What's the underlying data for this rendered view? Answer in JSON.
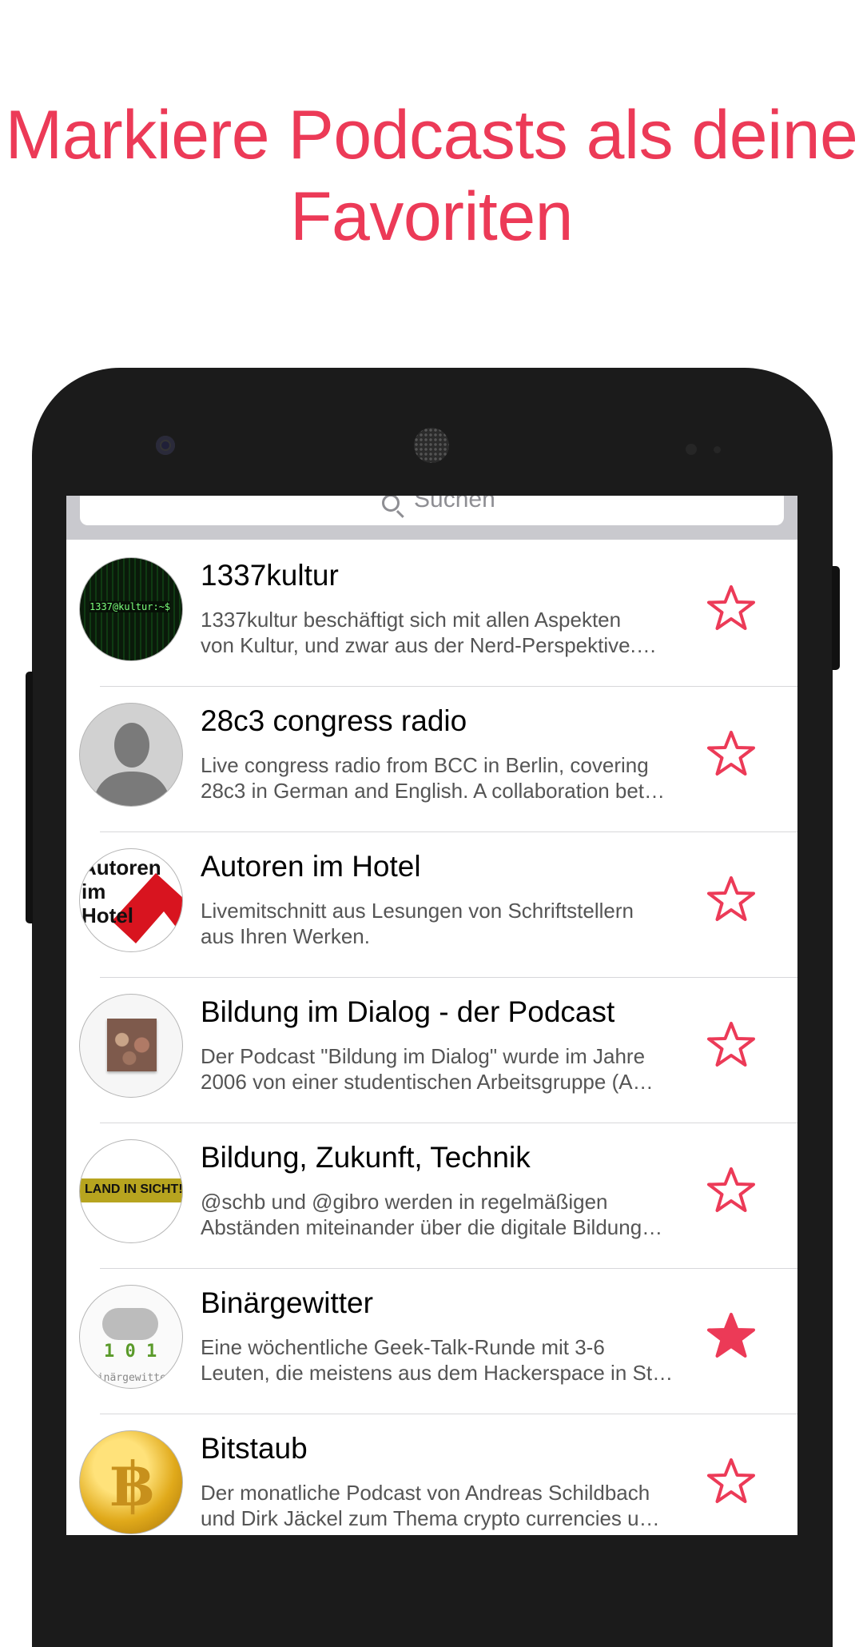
{
  "headline": {
    "line1": "Markiere Podcasts als deine",
    "line2": "Favoriten"
  },
  "colors": {
    "accent": "#ec3a57",
    "phone_body": "#1b1b1b"
  },
  "search": {
    "placeholder": "Suchen",
    "icon": "search-icon"
  },
  "podcasts": [
    {
      "title": "1337kultur",
      "desc_line1": "1337kultur beschäftigt sich mit allen Aspekten",
      "desc_line2": "von Kultur, und zwar aus der Nerd-Perspektive.…",
      "avatar_text": "1337@kultur:~$",
      "favorite": false
    },
    {
      "title": "28c3 congress radio",
      "desc_line1": "Live congress radio from BCC in Berlin, covering",
      "desc_line2": "28c3 in German and English. A collaboration bet…",
      "favorite": false
    },
    {
      "title": "Autoren im Hotel",
      "desc_line1": "Livemitschnitt aus Lesungen von Schriftstellern",
      "desc_line2": "aus Ihren Werken.",
      "avatar_text": "Autoren im Hotel",
      "favorite": false
    },
    {
      "title": "Bildung im Dialog - der Podcast",
      "desc_line1": "Der Podcast \"Bildung im Dialog\" wurde im Jahre",
      "desc_line2": "2006 von einer studentischen Arbeitsgruppe (A…",
      "favorite": false
    },
    {
      "title": "Bildung, Zukunft, Technik",
      "desc_line1": "@schb und @gibro werden in regelmäßigen",
      "desc_line2": "Abständen miteinander über die digitale Bildung…",
      "avatar_text": "LAND IN SICHT!",
      "favorite": false
    },
    {
      "title": "Binärgewitter",
      "desc_line1": "Eine wöchentliche Geek-Talk-Runde mit 3-6",
      "desc_line2": "Leuten, die meistens aus dem Hackerspace in St…",
      "avatar_text": "binärgewitter",
      "favorite": true
    },
    {
      "title": "Bitstaub",
      "desc_line1": "Der monatliche Podcast von Andreas Schildbach",
      "desc_line2": "und Dirk Jäckel zum Thema crypto currencies u…",
      "favorite": false
    }
  ]
}
